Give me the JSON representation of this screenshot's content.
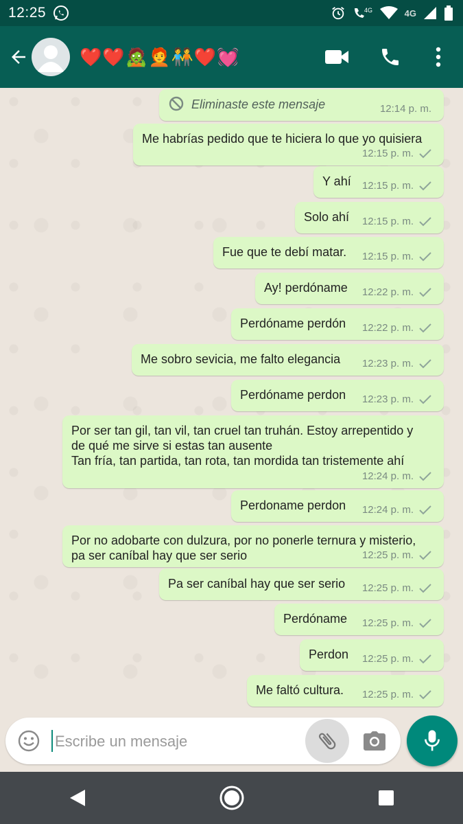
{
  "status_bar": {
    "time": "12:25",
    "network": "4G",
    "network2": "4G"
  },
  "header": {
    "contact_name": "❤️❤️🧟🧑‍🦰🧑‍🤝‍🧑❤️💓"
  },
  "messages": [
    {
      "text": "Eliminaste este mensaje",
      "time": "12:14 p. m.",
      "deleted": true
    },
    {
      "text": "Me habrías pedido que te hiciera lo que yo quisiera",
      "time": "12:15 p. m."
    },
    {
      "text": "Y ahí",
      "time": "12:15 p. m."
    },
    {
      "text": "Solo ahí",
      "time": "12:15 p. m."
    },
    {
      "text": "Fue que te debí matar.",
      "time": "12:15 p. m."
    },
    {
      "text": "Ay! perdóname",
      "time": "12:22 p. m."
    },
    {
      "text": "Perdóname perdón",
      "time": "12:22 p. m."
    },
    {
      "text": "Me sobro sevicia, me falto elegancia",
      "time": "12:23 p. m."
    },
    {
      "text": "Perdóname perdon",
      "time": "12:23 p. m."
    },
    {
      "text": "Por ser tan gil, tan vil, tan cruel tan truhán. Estoy arrepentido y\nde qué me sirve si estas tan ausente\nTan fría, tan partida, tan rota, tan mordida tan tristemente ahí",
      "time": "12:24 p. m."
    },
    {
      "text": "Perdoname perdon",
      "time": "12:24 p. m."
    },
    {
      "text": "Por no adobarte con dulzura, por no ponerle ternura y misterio,\npa ser caníbal hay que ser serio",
      "time": "12:25 p. m."
    },
    {
      "text": "Pa ser caníbal hay que ser serio",
      "time": "12:25 p. m."
    },
    {
      "text": "Perdóname",
      "time": "12:25 p. m."
    },
    {
      "text": "Perdon",
      "time": "12:25 p. m."
    },
    {
      "text": "Me faltó cultura.",
      "time": "12:25 p. m."
    }
  ],
  "input": {
    "placeholder": "Escribe un mensaje"
  },
  "colors": {
    "header": "#075e54",
    "status_bar": "#054d44",
    "bubble_out": "#dcf8c6",
    "chat_bg": "#ece5dd",
    "accent": "#00897b"
  }
}
